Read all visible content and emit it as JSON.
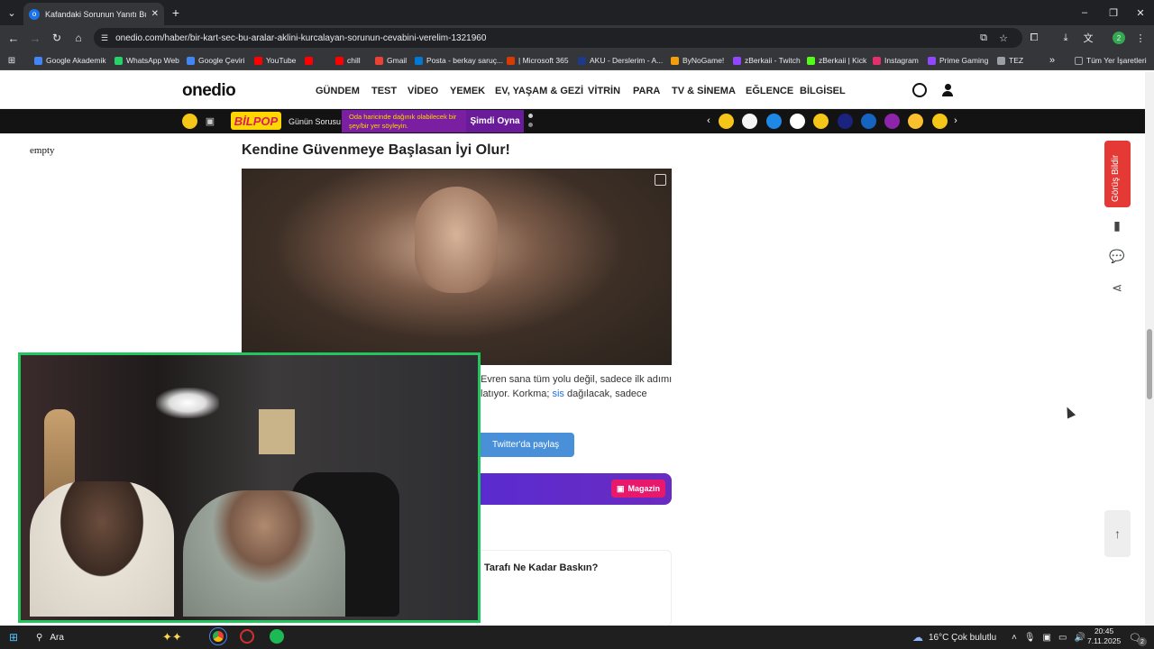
{
  "browser": {
    "tab_title": "Kafandaki Sorunun Yanıtı Bu Ka...",
    "url": "onedio.com/haber/bir-kart-sec-bu-aralar-aklini-kurcalayan-sorunun-cevabini-verelim-1321960",
    "profile_initial": "2",
    "bookmarks": [
      {
        "label": "Google Akademik",
        "color": "#4285f4"
      },
      {
        "label": "WhatsApp Web",
        "color": "#25d366"
      },
      {
        "label": "Google Çeviri",
        "color": "#4285f4"
      },
      {
        "label": "YouTube",
        "color": "#ff0000"
      },
      {
        "label": "",
        "color": "#ff0000"
      },
      {
        "label": "chill",
        "color": "#ff0000"
      },
      {
        "label": "Gmail",
        "color": "#ea4335"
      },
      {
        "label": "Posta - berkay saruç...",
        "color": "#0078d4"
      },
      {
        "label": "| Microsoft 365",
        "color": "#d83b01"
      },
      {
        "label": "AKU - Derslerim - A...",
        "color": "#1e3a8a"
      },
      {
        "label": "ByNoGame!",
        "color": "#f59e0b"
      },
      {
        "label": "zBerkaii - Twitch",
        "color": "#9146ff"
      },
      {
        "label": "zBerkaii | Kick",
        "color": "#53fc18"
      },
      {
        "label": "Instagram",
        "color": "#e1306c"
      },
      {
        "label": "Prime Gaming",
        "color": "#9146ff"
      },
      {
        "label": "TEZ",
        "color": "#9aa0a6"
      }
    ],
    "all_bookmarks": "Tüm Yer İşaretleri"
  },
  "site": {
    "logo": "onedio",
    "nav": [
      "GÜNDEM",
      "TEST",
      "VİDEO",
      "YEMEK",
      "EV, YAŞAM & GEZİ",
      "VİTRİN",
      "PARA",
      "TV & SİNEMA",
      "EĞLENCE",
      "BİLGİSEL"
    ],
    "bilpop": {
      "brand": "BİLPOP",
      "question_label": "Günün Sorusu",
      "question_text_1": "Oda haricinde dağınık olabilecek bir",
      "question_text_2": "şey/bir yer söyleyin.",
      "cta": "Şimdi Oyna"
    },
    "category_colors": [
      "#f5c518",
      "#f5f5f5",
      "#1e88e5",
      "#ffffff",
      "#f5c518",
      "#1a237e",
      "#1565c0",
      "#8e24aa",
      "#fbc02d",
      "#f5c518"
    ]
  },
  "article": {
    "empty_label": "empty",
    "heading": "Kendine Güvenmeye Başlasan İyi Olur!",
    "body_line_1": "Evren sana tüm yolu değil, sadece ilk adımı",
    "body_line_2_a": "latıyor. Korkma;",
    "body_line_2_link": "sis",
    "body_line_2_b": "dağılacak, sadece",
    "share_button": "Twitter'da paylaş",
    "magazine_label": "Magazin",
    "quiz_title": "Tarafı Ne Kadar Baskın?"
  },
  "right_rail": {
    "feedback_label": "Görüş Bildir"
  },
  "taskbar": {
    "search_label": "Ara",
    "weather": "16°C  Çok bulutlu",
    "time": "20:45",
    "date": "7.11.2025",
    "notification_count": "2"
  }
}
